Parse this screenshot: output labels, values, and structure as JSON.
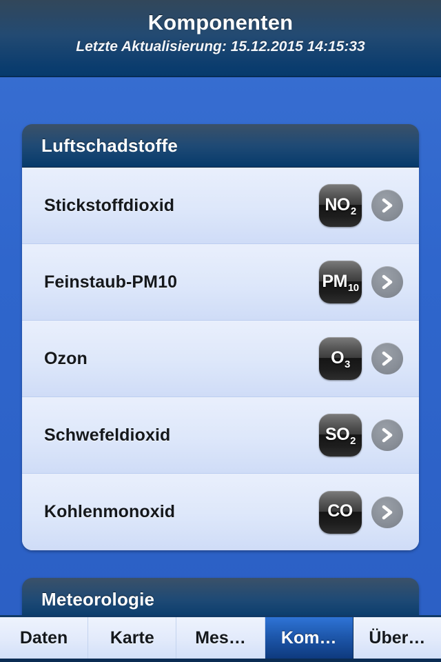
{
  "header": {
    "title": "Komponenten",
    "subtitle": "Letzte Aktualisierung: 15.12.2015 14:15:33"
  },
  "colors": {
    "body_blue": "#2f66cc",
    "header_navy": "#063a6b",
    "row_light": "#e9effc",
    "row_dark": "#cfdcf7",
    "active_tab_blue": "#1e58ad",
    "chevron_gray": "#8a9099",
    "badge_dark": "#151515"
  },
  "cards": [
    {
      "title": "Luftschadstoffe",
      "rows": [
        {
          "label": "Stickstoffdioxid",
          "badge_main": "NO",
          "badge_sub": "2"
        },
        {
          "label": "Feinstaub-PM10",
          "badge_main": "PM",
          "badge_sub": "10"
        },
        {
          "label": "Ozon",
          "badge_main": "O",
          "badge_sub": "3"
        },
        {
          "label": "Schwefeldioxid",
          "badge_main": "SO",
          "badge_sub": "2"
        },
        {
          "label": "Kohlenmonoxid",
          "badge_main": "CO",
          "badge_sub": ""
        }
      ]
    },
    {
      "title": "Meteorologie",
      "rows": []
    }
  ],
  "tabbar": {
    "tabs": [
      {
        "label": "Daten",
        "active": false
      },
      {
        "label": "Karte",
        "active": false
      },
      {
        "label": "Mes…",
        "active": false
      },
      {
        "label": "Kom…",
        "active": true
      },
      {
        "label": "Über…",
        "active": false
      }
    ]
  }
}
